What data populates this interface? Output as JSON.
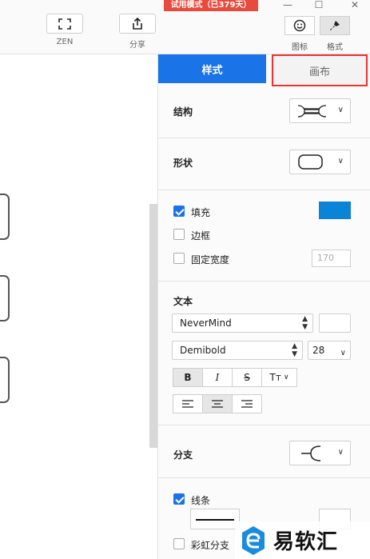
{
  "toolbar": {
    "zen_label": "ZEN",
    "share_label": "分享",
    "trial_badge": "试用模式（已379天）",
    "icon_tab_label": "图标",
    "style_tab_label": "格式"
  },
  "panel": {
    "tabs": {
      "style": "样式",
      "canvas": "画布"
    },
    "structure": {
      "title": "结构"
    },
    "shape": {
      "title": "形状"
    },
    "fill": {
      "label": "填充",
      "checked": true,
      "color": "#0a84d6"
    },
    "border": {
      "label": "边框",
      "checked": false
    },
    "fixed_width": {
      "label": "固定宽度",
      "checked": false,
      "value": "170"
    },
    "text": {
      "title": "文本",
      "font": "NeverMind",
      "weight": "Demibold",
      "size": "28",
      "bold": "B",
      "italic": "I",
      "strike": "S",
      "case": "Tт"
    },
    "branch": {
      "title": "分支"
    },
    "line": {
      "label": "线条",
      "checked": true
    },
    "rainbow": {
      "label": "彩虹分支",
      "checked": false
    }
  },
  "watermark": {
    "text": "易软汇"
  }
}
